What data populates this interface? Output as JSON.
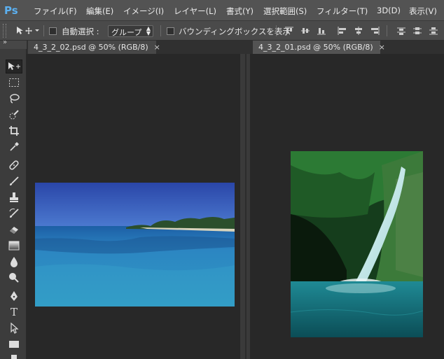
{
  "app": {
    "logo": "Ps"
  },
  "menu": [
    {
      "label": "ファイル(F)",
      "name": "menu-file"
    },
    {
      "label": "編集(E)",
      "name": "menu-edit"
    },
    {
      "label": "イメージ(I)",
      "name": "menu-image"
    },
    {
      "label": "レイヤー(L)",
      "name": "menu-layer"
    },
    {
      "label": "書式(Y)",
      "name": "menu-type"
    },
    {
      "label": "選択範囲(S)",
      "name": "menu-select"
    },
    {
      "label": "フィルター(T)",
      "name": "menu-filter"
    },
    {
      "label": "3D(D)",
      "name": "menu-3d"
    },
    {
      "label": "表示(V)",
      "name": "menu-view"
    }
  ],
  "options": {
    "auto_select_label": "自動選択 :",
    "auto_select_value": "グループ",
    "bounding_box_label": "バウンディングボックスを表示"
  },
  "tabs": [
    {
      "label": "4_3_2_02.psd @ 50% (RGB/8)",
      "close": "×"
    },
    {
      "label": "4_3_2_01.psd @ 50% (RGB/8)",
      "close": "×"
    }
  ],
  "toolbar_collapse": "»",
  "colors": {
    "accent": "#5cb0f0",
    "panel": "#535353",
    "canvas": "#282828"
  }
}
